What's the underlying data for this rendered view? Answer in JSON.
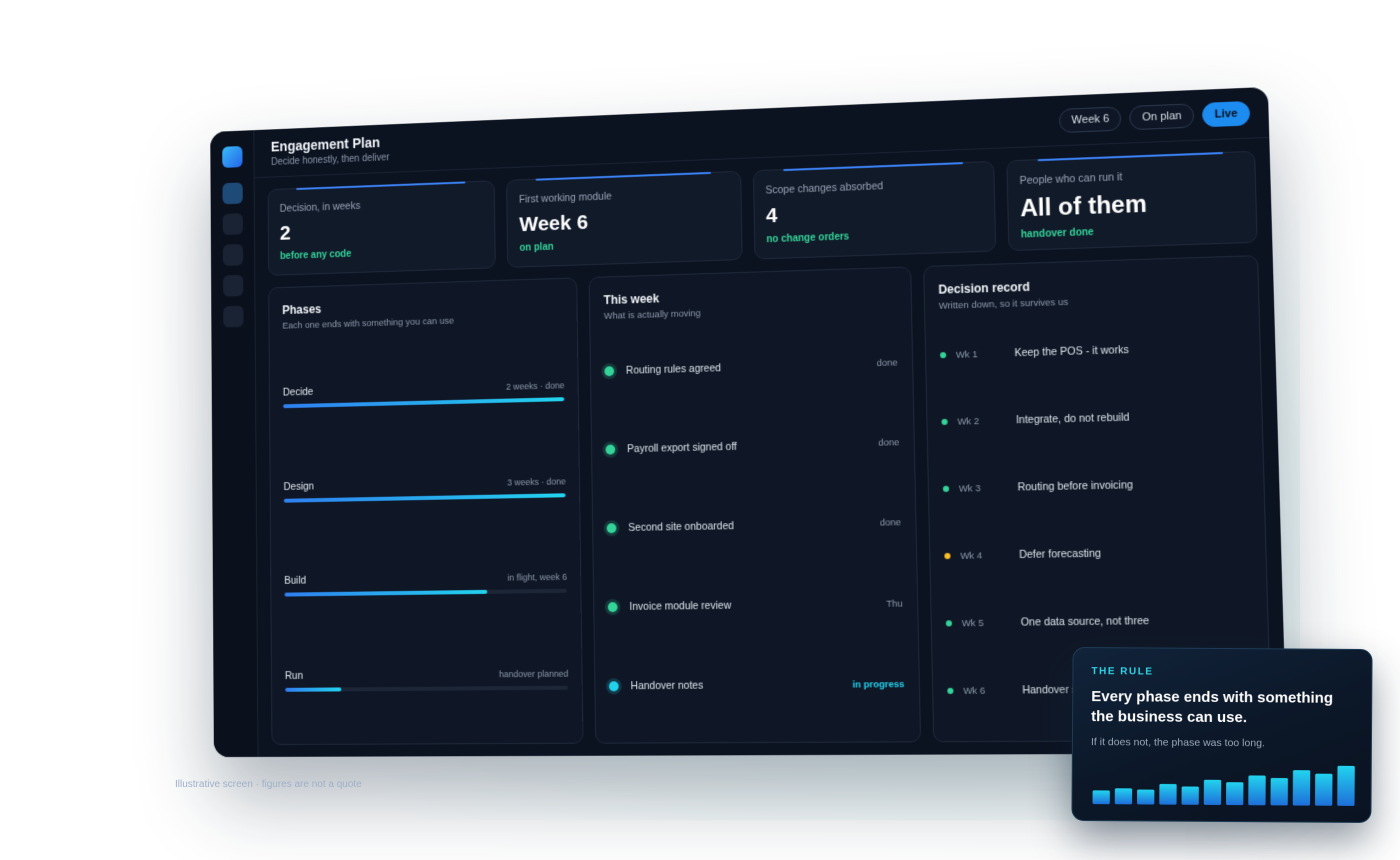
{
  "header": {
    "title": "Engagement Plan",
    "subtitle": "Decide honestly, then deliver",
    "pills": [
      "Week 6",
      "On plan"
    ],
    "live_label": "Live"
  },
  "stats": [
    {
      "label": "Decision, in weeks",
      "value": "2",
      "note": "before any code"
    },
    {
      "label": "First working module",
      "value": "Week 6",
      "note": "on plan"
    },
    {
      "label": "Scope changes absorbed",
      "value": "4",
      "note": "no change orders"
    },
    {
      "label": "People who can run it",
      "value": "All of them",
      "note": "handover done"
    }
  ],
  "phases": {
    "title": "Phases",
    "subtitle": "Each one ends with something you can use",
    "items": [
      {
        "name": "Decide",
        "meta": "2 weeks · done",
        "progress": 1.0
      },
      {
        "name": "Design",
        "meta": "3 weeks · done",
        "progress": 1.0
      },
      {
        "name": "Build",
        "meta": "in flight, week 6",
        "progress": 0.72
      },
      {
        "name": "Run",
        "meta": "handover planned",
        "progress": 0.2
      }
    ]
  },
  "week": {
    "title": "This week",
    "subtitle": "What is actually moving",
    "items": [
      {
        "label": "Routing rules agreed",
        "status": "done"
      },
      {
        "label": "Payroll export signed off",
        "status": "done"
      },
      {
        "label": "Second site onboarded",
        "status": "done"
      },
      {
        "label": "Invoice module review",
        "status": "Thu"
      },
      {
        "label": "Handover notes",
        "status": "in progress"
      }
    ]
  },
  "decisions": {
    "title": "Decision record",
    "subtitle": "Written down, so it survives us",
    "items": [
      {
        "week": "Wk 1",
        "text": "Keep the POS - it works",
        "status_color": "#34d399"
      },
      {
        "week": "Wk 2",
        "text": "Integrate, do not rebuild",
        "status_color": "#34d399"
      },
      {
        "week": "Wk 3",
        "text": "Routing before invoicing",
        "status_color": "#34d399"
      },
      {
        "week": "Wk 4",
        "text": "Defer forecasting",
        "status_color": "#fbbf24"
      },
      {
        "week": "Wk 5",
        "text": "One data source, not three",
        "status_color": "#34d399"
      },
      {
        "week": "Wk 6",
        "text": "Handover starts",
        "status_color": "#34d399"
      }
    ]
  },
  "rule": {
    "kicker": "THE RULE",
    "headline": "Every phase ends with something the business can use.",
    "body": "If it does not, the phase was too long."
  },
  "chart_data": {
    "type": "bar",
    "values": [
      12,
      14,
      13,
      18,
      16,
      22,
      20,
      26,
      24,
      31,
      28,
      35
    ]
  },
  "footnote": "Illustrative screen · figures are not a quote"
}
